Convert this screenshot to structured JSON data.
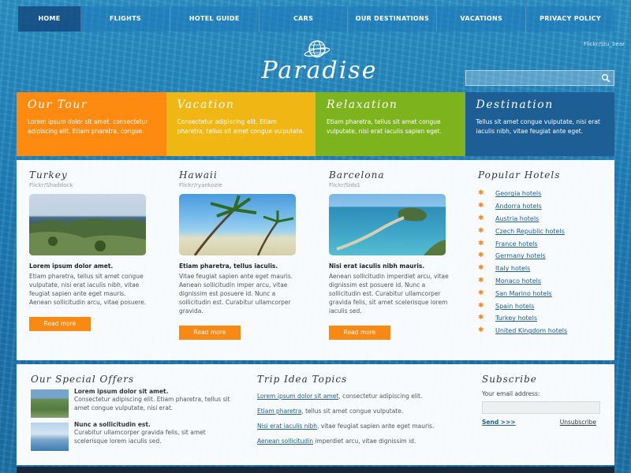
{
  "nav": {
    "items": [
      "HOME",
      "FLIGHTS",
      "HOTEL GUIDE",
      "CARS",
      "OUR DESTINATIONS",
      "VACATIONS",
      "PRIVACY POLICY"
    ]
  },
  "header": {
    "photo_credit": "Flickr/Stu_bear",
    "logo_text": "Paradise",
    "logo_icon": "globe-icon"
  },
  "search": {
    "value": "",
    "icon": "search-icon"
  },
  "banner": [
    {
      "title": "Our Tour",
      "text": "Lorem ipsum dolor sit amet, consectetur adipiscing elit. Etiam pharetra, congue.",
      "color": "#ff8a10"
    },
    {
      "title": "Vacation",
      "text": "Consectetur adipiscing elit. Etiam pharetra, tellus sit amet congue vulputate.",
      "color": "#f0b614"
    },
    {
      "title": "Relaxation",
      "text": "Etiam pharetra, tellus sit amet congue vulputate, nisi erat iaculis sapien eget.",
      "color": "#7db31c"
    },
    {
      "title": "Destination",
      "text": "Tellus sit amet congue vulputate, nisi erat iaculis nibh, vitae feugiat ante eget.",
      "color": "#1d5e95"
    }
  ],
  "destinations": [
    {
      "title": "Turkey",
      "credit": "Flickr/Shaddock",
      "heading": "Lorem ipsum dolor amet.",
      "text": "Etiam pharetra, tellus sit amet congue vulputate, nisi erat iaculis nibh, vitae feugiat sapien ante eget mauris. Aenean sollicitudin arcu, vitae posuere.",
      "button": "Read more"
    },
    {
      "title": "Hawaii",
      "credit": "Flickr/ryankozie",
      "heading": "Etiam pharetra, tellus iaculis.",
      "text": "Vitae feugiat sapien ante eget mauris. Aenean sollicitudin imper arcu, vitae dignissim est posuere id. Nunc a sollicitudin est. Curabitur ullamcorper gravida.",
      "button": "Read more"
    },
    {
      "title": "Barcelona",
      "credit": "Flickr/Sids1",
      "heading": "Nisi erat iaculis nibh mauris.",
      "text": "Aenean sollicitudin imperdiet arcu, vitae dignissim est posuere id. Nunc a sollicitudin est. Curabitur ullamcorper gravida felis, sit amet scelerisque lorem iaculis sed.",
      "button": "Read more"
    }
  ],
  "popular": {
    "title": "Popular Hotels",
    "items": [
      "Georgia hotels",
      "Andorra hotels",
      "Austria hotels",
      "Czech Republic hotels",
      "France hotels",
      "Germany hotels",
      "Italy hotels",
      "Monaco hotels",
      "San Marino hotels",
      "Spain hotels",
      "Turkey hotels",
      "United Kingdom hotels"
    ]
  },
  "offers": {
    "title": "Our Special Offers",
    "items": [
      {
        "heading": "Lorem ipsum dolor sit amet.",
        "text": "Consectetur adipiscing elit. Etiam pharetra, tellus sit amet congue vulputate, nisi erat."
      },
      {
        "heading": "Nunc a sollicitudin est.",
        "text": "Curabitur ullamcorper gravida felis, sit amet scelerisque lorem iaculis sed."
      }
    ]
  },
  "topics": {
    "title": "Trip Idea Topics",
    "items": [
      {
        "link": "Lorem ipsum dolor sit amet",
        "text": ", consectetur adipiscing elit."
      },
      {
        "link": "Etiam pharetra",
        "text": ", tellus sit amet congue vulputate."
      },
      {
        "link": "Nisi erat iaculis nibh",
        "text": ", vitae feugiat sapien ante eget mauris."
      },
      {
        "link": "Aenean sollicitudin",
        "text": " imperdiet arcu, vitae dignissim id."
      }
    ]
  },
  "subscribe": {
    "title": "Subscribe",
    "label": "Your email address:",
    "value": "",
    "send": "Send >>>",
    "unsubscribe": "Unsubscribe"
  }
}
